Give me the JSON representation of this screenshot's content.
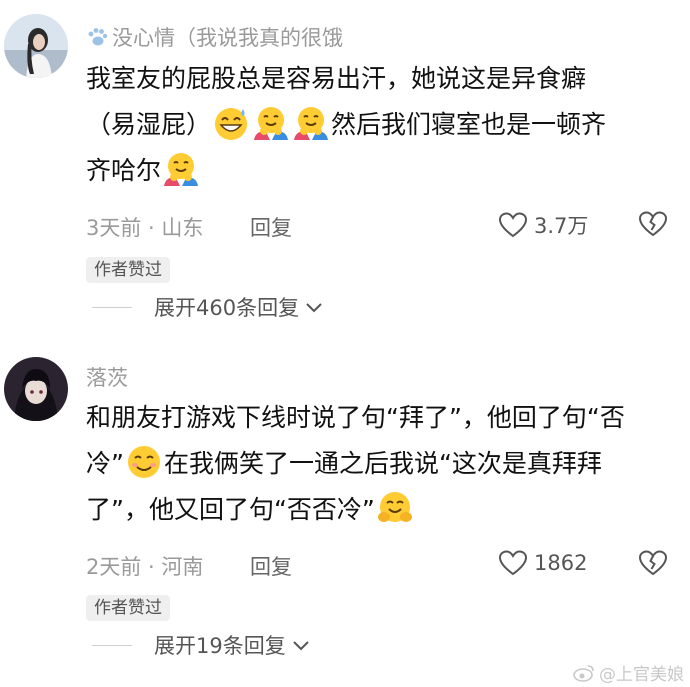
{
  "comments": [
    {
      "username": "没心情（我说我真的很饿",
      "paw_icon": "paw-icon",
      "lines": [
        {
          "text": "我室友的屁股总是容易出汗，她说这是异食癖"
        },
        {
          "pre": "（易湿屁）",
          "emojis": [
            "grin-sweat-emoji",
            "hugging-face-emoji",
            "hugging-face-emoji"
          ],
          "post": "然后我们寝室也是一顿齐"
        },
        {
          "pre": "齐哈尔",
          "emojis": [
            "hugging-face-emoji"
          ],
          "post": ""
        }
      ],
      "time": "3天前 · 山东",
      "reply": "回复",
      "likes": "3.7万",
      "badge": "作者赞过",
      "expand": "展开460条回复"
    },
    {
      "username": "落茨",
      "lines": [
        {
          "text": "和朋友打游戏下线时说了句“拜了”，他回了句“否"
        },
        {
          "pre": "冷”",
          "emojis": [
            "blush-smile-emoji"
          ],
          "post": "在我俩笑了一通之后我说“这次是真拜拜"
        },
        {
          "pre": "了”，他又回了句“否否冷”",
          "emojis": [
            "hugging-hands-emoji"
          ],
          "post": ""
        }
      ],
      "time": "2天前 · 河南",
      "reply": "回复",
      "likes": "1862",
      "badge": "作者赞过",
      "expand": "展开19条回复"
    }
  ],
  "watermark": "@上官美娘"
}
